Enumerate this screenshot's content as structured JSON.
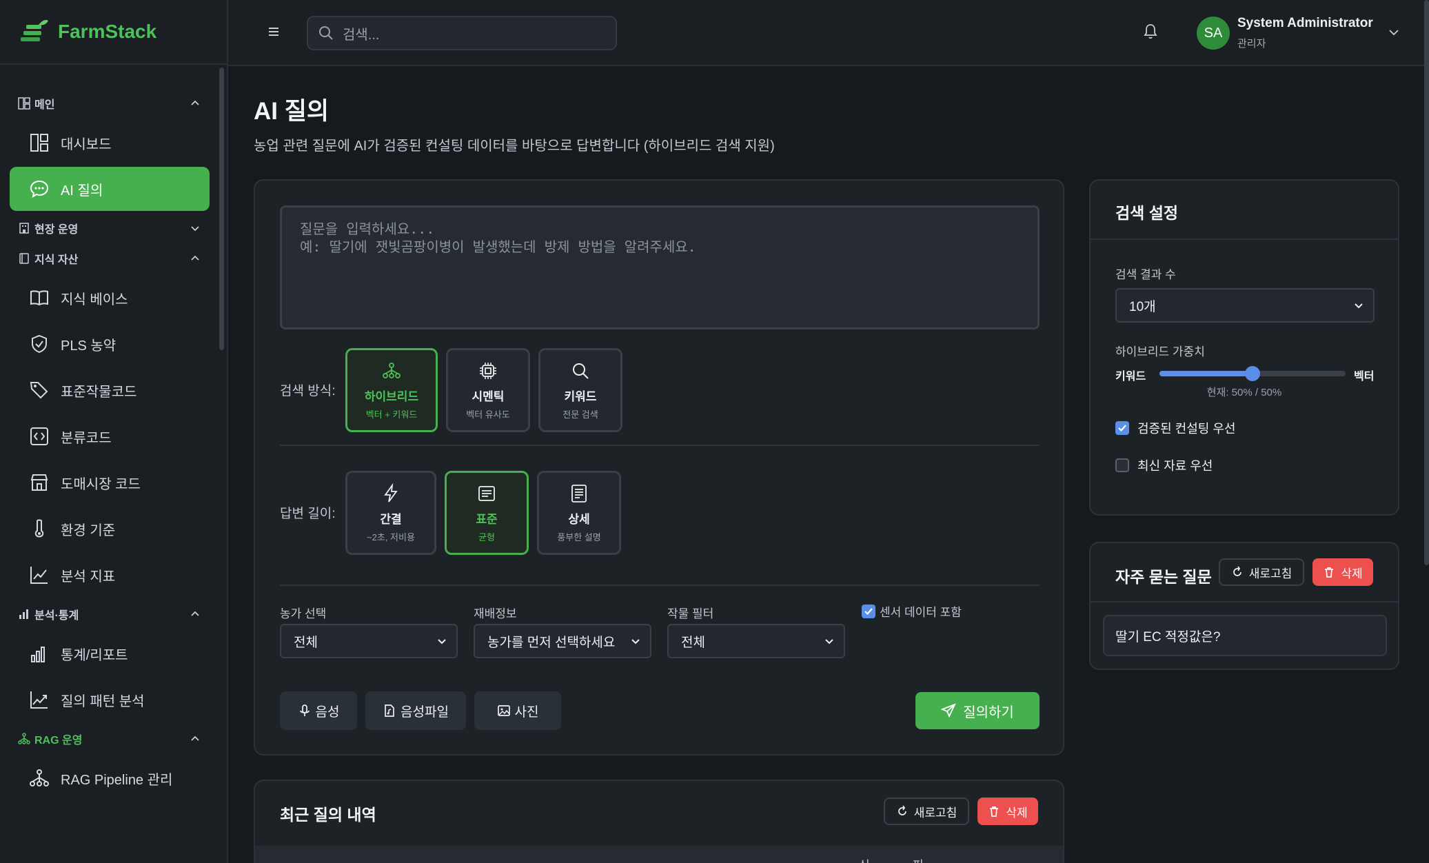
{
  "app": {
    "name": "FarmStack",
    "brand_color": "#46b04f"
  },
  "sidebar": {
    "sections": [
      {
        "label": "메인",
        "icon": "layout-icon"
      },
      {
        "label": "현장 운영",
        "icon": "building-icon"
      },
      {
        "label": "지식 자산",
        "icon": "book-icon"
      },
      {
        "label": "분석·통계",
        "icon": "chart-icon"
      },
      {
        "label": "RAG 운영",
        "icon": "network-icon"
      }
    ],
    "items": [
      {
        "label": "대시보드",
        "icon": "dashboard-icon"
      },
      {
        "label": "AI 질의",
        "icon": "chat-icon",
        "active": true
      },
      {
        "label": "지식 베이스",
        "icon": "book-open-icon"
      },
      {
        "label": "PLS 농약",
        "icon": "shield-icon"
      },
      {
        "label": "표준작물코드",
        "icon": "tag-icon"
      },
      {
        "label": "분류코드",
        "icon": "code-icon"
      },
      {
        "label": "도매시장 코드",
        "icon": "store-icon"
      },
      {
        "label": "환경 기준",
        "icon": "thermometer-icon"
      },
      {
        "label": "분석 지표",
        "icon": "line-chart-icon"
      },
      {
        "label": "통계/리포트",
        "icon": "bar-chart-icon"
      },
      {
        "label": "질의 패턴 분석",
        "icon": "trend-icon"
      },
      {
        "label": "RAG Pipeline 관리",
        "icon": "network-icon"
      }
    ]
  },
  "topbar": {
    "search_placeholder": "검색...",
    "user": {
      "initials": "SA",
      "name": "System Administrator",
      "role": "관리자"
    }
  },
  "page": {
    "title": "AI 질의",
    "subtitle": "농업 관련 질문에 AI가 검증된 컨설팅 데이터를 바탕으로 답변합니다 (하이브리드 검색 지원)"
  },
  "query": {
    "placeholder": "질문을 입력하세요...\n예: 딸기에 잿빛곰팡이병이 발생했는데 방제 방법을 알려주세요.",
    "search_mode_label": "검색 방식:",
    "search_modes": [
      {
        "title": "하이브리드",
        "sub": "벡터 + 키워드",
        "icon": "hierarchy-icon",
        "selected": true
      },
      {
        "title": "시멘틱",
        "sub": "벡터 유사도",
        "icon": "chip-icon",
        "selected": false
      },
      {
        "title": "키워드",
        "sub": "전문 검색",
        "icon": "search-icon",
        "selected": false
      }
    ],
    "length_label": "답변 길이:",
    "lengths": [
      {
        "title": "간결",
        "sub": "~2초, 저비용",
        "icon": "bolt-icon",
        "selected": false
      },
      {
        "title": "표준",
        "sub": "균형",
        "icon": "document-icon",
        "selected": true
      },
      {
        "title": "상세",
        "sub": "풍부한 설명",
        "icon": "list-doc-icon",
        "selected": false
      }
    ],
    "filters": {
      "farm_label": "농가 선택",
      "farm_value": "전체",
      "cultivation_label": "재배정보",
      "cultivation_value": "농가를 먼저 선택하세요",
      "crop_label": "작물 필터",
      "crop_value": "전체",
      "sensor_label": "센서 데이터 포함",
      "sensor_checked": true
    },
    "buttons": {
      "voice": "음성",
      "voice_file": "음성파일",
      "photo": "사진",
      "submit": "질의하기"
    }
  },
  "recent": {
    "title": "최근 질의 내역",
    "refresh": "새로고침",
    "delete": "삭제",
    "partial_headers": [
      "신",
      "피"
    ]
  },
  "settings": {
    "title": "검색 설정",
    "count_label": "검색 결과 수",
    "count_value": "10개",
    "weight_label": "하이브리드 가중치",
    "weight_left": "키워드",
    "weight_right": "벡터",
    "weight_now": "현재: 50% / 50%",
    "weight_value": 0.5,
    "verified_label": "검증된 컨설팅 우선",
    "verified_checked": true,
    "recent_label": "최신 자료 우선",
    "recent_checked": false
  },
  "faq": {
    "title": "자주 묻는 질문",
    "refresh": "새로고침",
    "delete": "삭제",
    "items": [
      "딸기 EC 적정값은?"
    ]
  }
}
